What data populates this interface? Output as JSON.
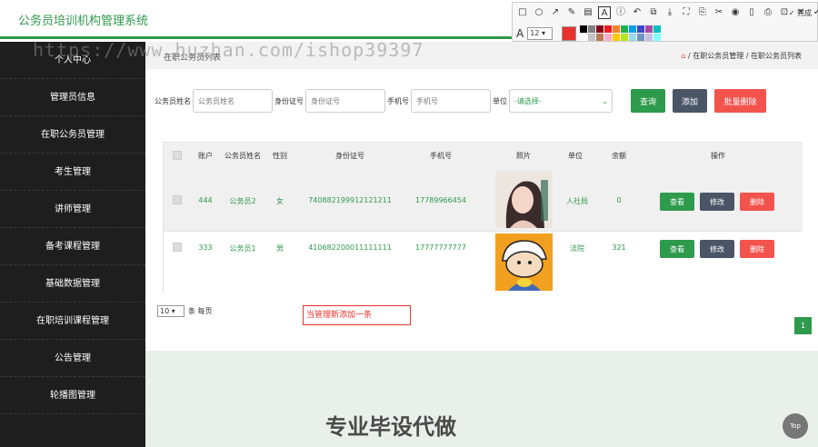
{
  "app": {
    "title": "公务员培训机构管理系统"
  },
  "screenshot_toolbar": {
    "tools": [
      "□",
      "○",
      "↗",
      "✎",
      "▤",
      "A",
      "ⓘ",
      "↶",
      "⧉",
      "⤓",
      "⛶",
      "⎘",
      "✂",
      "◉",
      "▯",
      "⎙",
      "⊡",
      "✕",
      "✓"
    ],
    "done_label": "完成",
    "font_label": "A",
    "font_size": "12",
    "current_color": "#e8322d",
    "palette": [
      "#000000",
      "#7f7f7f",
      "#880015",
      "#ed1c24",
      "#ff7f27",
      "#22b14c",
      "#00a2e8",
      "#3f48cc",
      "#a349a4",
      "#00c0c0",
      "#ffffff",
      "#c3c3c3",
      "#b97a57",
      "#ffaec9",
      "#ffc90e",
      "#b5e61d",
      "#99d9ea",
      "#7092be",
      "#c8bfe7",
      "#80ffff"
    ]
  },
  "sidebar": {
    "items": [
      {
        "label": "个人中心"
      },
      {
        "label": "管理员信息"
      },
      {
        "label": "在职公务员管理"
      },
      {
        "label": "考生管理"
      },
      {
        "label": "讲师管理"
      },
      {
        "label": "备考课程管理"
      },
      {
        "label": "基础数据管理"
      },
      {
        "label": "在职培训课程管理"
      },
      {
        "label": "公告管理"
      },
      {
        "label": "轮播图管理"
      }
    ]
  },
  "breadcrumb": {
    "left": "在职公务员列表",
    "home_icon": "home-icon",
    "path": [
      "在职公务员管理",
      "在职公务员列表"
    ],
    "sep": "/"
  },
  "search": {
    "name_label": "公务员姓名",
    "name_placeholder": "公务员姓名",
    "id_label": "身份证号",
    "id_placeholder": "身份证号",
    "phone_label": "手机号",
    "phone_placeholder": "手机号",
    "unit_label": "单位",
    "unit_value": "-请选择-",
    "query_btn": "查询",
    "add_btn": "添加",
    "batch_delete_btn": "批量删除"
  },
  "table": {
    "columns": [
      "账户",
      "公务员姓名",
      "性别",
      "身份证号",
      "手机号",
      "照片",
      "单位",
      "余额",
      "操作"
    ],
    "rows": [
      {
        "account": "444",
        "name": "公务员2",
        "gender": "女",
        "id_no": "740882199912121211",
        "phone": "17789966454",
        "photo": "girl-portrait",
        "unit": "人社局",
        "balance": "0"
      },
      {
        "account": "333",
        "name": "公务员1",
        "gender": "男",
        "id_no": "410682200011111111",
        "phone": "17777777777",
        "photo": "cartoon-boy",
        "unit": "法院",
        "balance": "321"
      }
    ],
    "actions": {
      "view": "查看",
      "edit": "修改",
      "delete": "删除"
    }
  },
  "pager": {
    "page_size": "10",
    "per_page_label": "条 每页",
    "current_page": "1"
  },
  "annotation": {
    "text": "当管理新添加一条"
  },
  "watermark": {
    "top": "https://www.huzhan.com/ishop39397",
    "bottom": "专业毕设代做"
  },
  "top_button": "Top",
  "colors": {
    "primary": "#2e9a4c",
    "danger": "#f2534d",
    "dark": "#4a5566",
    "sidebar": "#1e1e1e"
  }
}
